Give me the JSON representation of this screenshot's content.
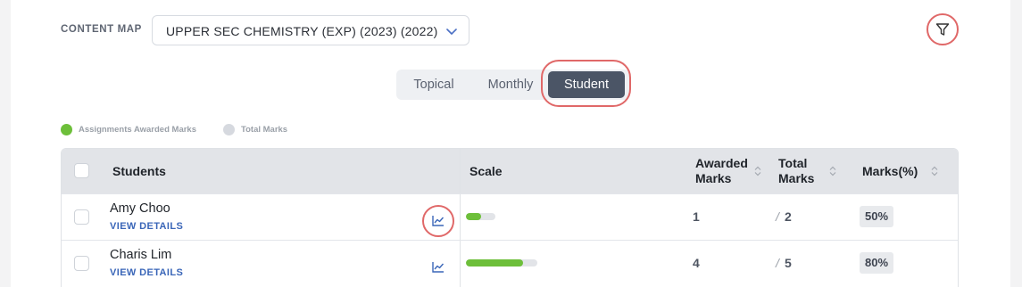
{
  "content_map": {
    "label": "CONTENT MAP",
    "selected": "UPPER SEC CHEMISTRY (EXP) (2023) (2022)"
  },
  "view_tabs": {
    "items": [
      "Topical",
      "Monthly",
      "Student"
    ],
    "active": "Student"
  },
  "legend": {
    "awarded": "Assignments Awarded Marks",
    "total": "Total Marks",
    "awarded_color": "#6dbf3a",
    "total_color": "#d6d9df"
  },
  "table": {
    "headers": {
      "students": "Students",
      "scale": "Scale",
      "awarded_line1": "Awarded",
      "awarded_line2": "Marks",
      "total_line1": "Total",
      "total_line2": "Marks",
      "percent": "Marks(%)"
    },
    "rows": [
      {
        "name": "Amy Choo",
        "link": "VIEW DETAILS",
        "awarded": "1",
        "slash": "/",
        "total": "2",
        "percent": "50%",
        "fill": 0.5
      },
      {
        "name": "Charis Lim",
        "link": "VIEW DETAILS",
        "awarded": "4",
        "slash": "/",
        "total": "5",
        "percent": "80%",
        "fill": 0.8
      }
    ]
  },
  "icons": {
    "filter": "filter-funnel-icon",
    "chart": "line-chart-icon",
    "chevron": "chevron-down-icon",
    "sort": "sort-arrows-icon"
  },
  "colors": {
    "accent_link": "#3a66b8",
    "active_tab": "#4b5566",
    "highlight_ring": "#e06868",
    "bar_fill": "#6dbf3a"
  }
}
